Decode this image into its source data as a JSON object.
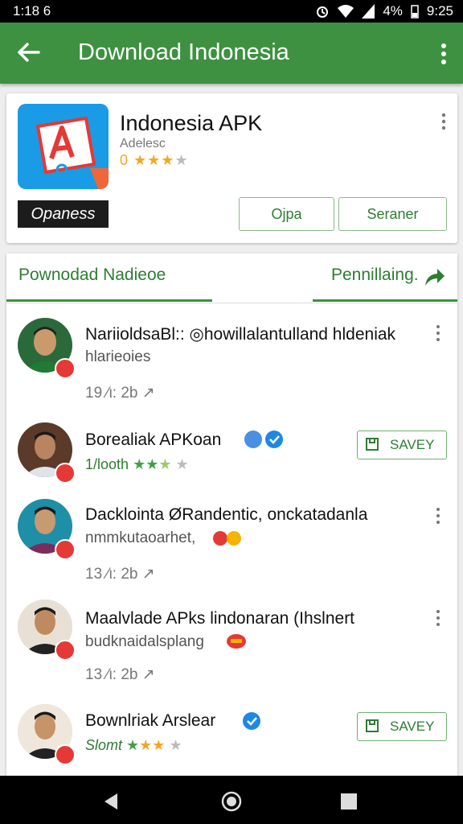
{
  "status_bar": {
    "time_left": "1:18 6",
    "right_text": "4%",
    "time_right": "9:25"
  },
  "app_bar": {
    "title": "Download Indonesia"
  },
  "app_card": {
    "name": "Indonesia APK",
    "publisher": "Adelesc",
    "rating_prefix": "0",
    "stars_filled": "★★★",
    "stars_empty": "★",
    "badge": "Opaness",
    "button1": "Ojpa",
    "button2": "Seraner"
  },
  "tabs": [
    {
      "label": "Pownodad Nadieoe"
    },
    {
      "label": "Pennillaing."
    }
  ],
  "list": [
    {
      "name": "NariioldsaBl:: ◎howillalantulland hldeniak",
      "sub": "hlarieoies",
      "meta": "19 ⁄ι:  2b ↗"
    },
    {
      "name": "Borealiak APKoan",
      "rating_text": "1/looth",
      "stars_green": "★★",
      "stars_gold": "★",
      "stars_empty": "★",
      "save": "SAVEY"
    },
    {
      "name": "Dacklointa ØRandentic, onckatadanla",
      "sub": "nmmkutaoarhet,",
      "meta": "13 ⁄ι:  2b ↗"
    },
    {
      "name": "Maalvlade APks lindonaran (Ihslnert",
      "sub": "budknaidalsplang",
      "meta": "13 ⁄ι:  2b ↗"
    },
    {
      "name": "Bownlriak Arslear",
      "rating_text": "Slomt",
      "stars_green": "★",
      "stars_gold": "★★",
      "stars_empty": "★",
      "save": "SAVEY"
    }
  ],
  "colors": {
    "primary": "#3d9140",
    "accent_green": "#2e7d32",
    "star": "#f5a623"
  }
}
